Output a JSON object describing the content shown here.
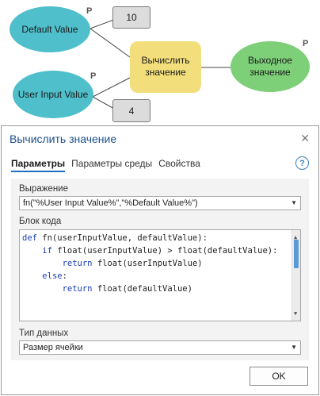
{
  "diagram": {
    "default_value": {
      "label": "Default Value",
      "value": "10",
      "p_flag": "P"
    },
    "user_input_value": {
      "label": "User Input Value",
      "value": "4",
      "p_flag": "P"
    },
    "tool": {
      "label_line1": "Вычислить",
      "label_line2": "значение"
    },
    "output": {
      "label_line1": "Выходное",
      "label_line2": "значение",
      "p_flag": "P"
    },
    "colors": {
      "variable": "#4ebfcb",
      "tool": "#f2df7c",
      "output": "#7dcf78"
    }
  },
  "dialog": {
    "title": "Вычислить значение",
    "close_icon": "close-icon",
    "tabs": [
      {
        "label": "Параметры",
        "active": true
      },
      {
        "label": "Параметры среды",
        "active": false
      },
      {
        "label": "Свойства",
        "active": false
      }
    ],
    "help_icon": "?",
    "expression": {
      "label": "Выражение",
      "value": "fn(\"%User Input Value%\",\"%Default Value%\")"
    },
    "code_block": {
      "label": "Блок кода",
      "lines": [
        "def fn(userInputValue, defaultValue):",
        "    if float(userInputValue) > float(defaultValue):",
        "        return float(userInputValue)",
        "    else:",
        "        return float(defaultValue)"
      ]
    },
    "data_type": {
      "label": "Тип данных",
      "value": "Размер ячейки"
    },
    "ok_label": "OK"
  }
}
